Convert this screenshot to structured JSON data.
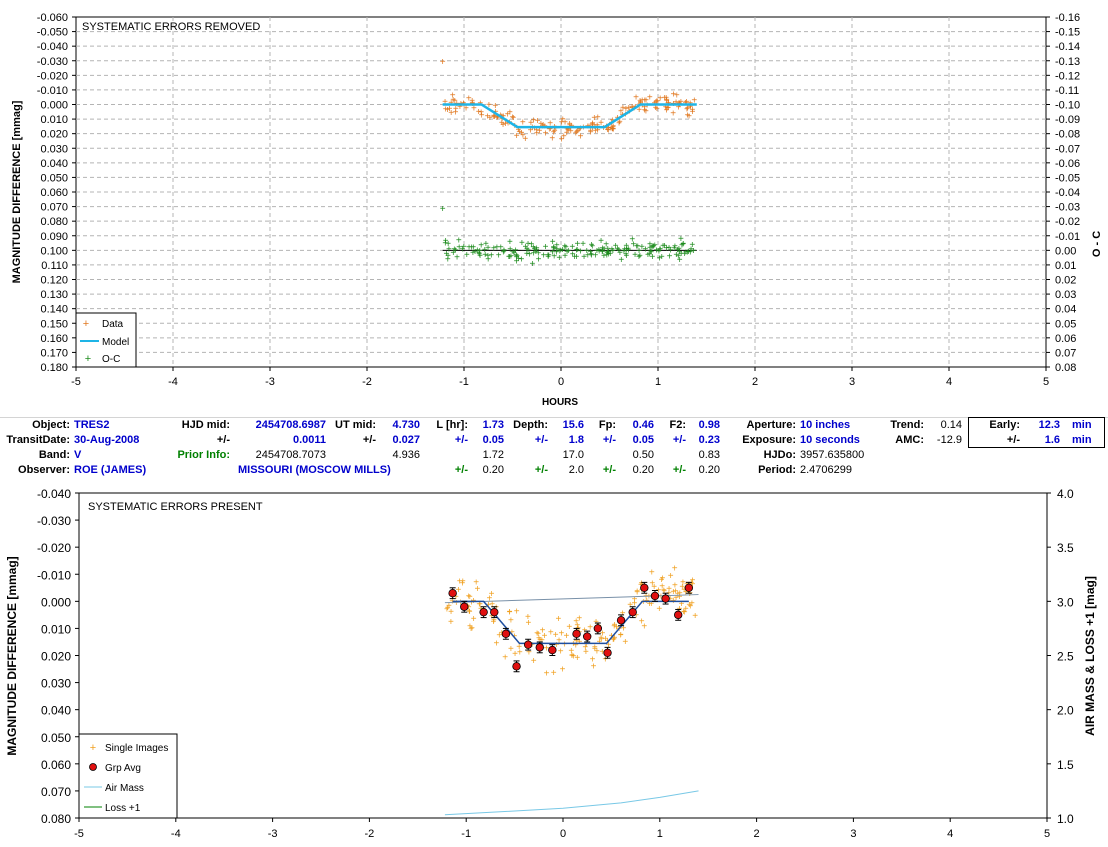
{
  "top": {
    "title": "SYSTEMATIC ERRORS REMOVED",
    "ylabel": "MAGNITUDE DIFFERENCE [mmag]",
    "y2label": "O - C",
    "xlabel": "HOURS",
    "yticks": [
      "-0.060",
      "-0.050",
      "-0.040",
      "-0.030",
      "-0.020",
      "-0.010",
      "0.000",
      "0.010",
      "0.020",
      "0.030",
      "0.040",
      "0.050",
      "0.060",
      "0.070",
      "0.080",
      "0.090",
      "0.100",
      "0.110",
      "0.120",
      "0.130",
      "0.140",
      "0.150",
      "0.160",
      "0.170",
      "0.180"
    ],
    "y2ticks": [
      "-0.16",
      "-0.15",
      "-0.14",
      "-0.13",
      "-0.12",
      "-0.11",
      "-0.10",
      "-0.09",
      "-0.08",
      "-0.07",
      "-0.06",
      "-0.05",
      "-0.04",
      "-0.03",
      "-0.02",
      "-0.01",
      "0.00",
      "0.01",
      "0.02",
      "0.03",
      "0.04",
      "0.05",
      "0.06",
      "0.07",
      "0.08"
    ],
    "xticks": [
      "-5",
      "-4",
      "-3",
      "-2",
      "-1",
      "0",
      "1",
      "2",
      "3",
      "4",
      "5"
    ],
    "legend": [
      "Data",
      "Model",
      "O-C"
    ]
  },
  "bottom": {
    "title": "SYSTEMATIC ERRORS PRESENT",
    "ylabel": "MAGNITUDE DIFFERENCE [mmag]",
    "y2label": "AIR MASS & LOSS +1 [mag]",
    "yticks": [
      "-0.040",
      "-0.030",
      "-0.020",
      "-0.010",
      "0.000",
      "0.010",
      "0.020",
      "0.030",
      "0.040",
      "0.050",
      "0.060",
      "0.070",
      "0.080"
    ],
    "y2ticks": [
      "4.0",
      "3.5",
      "3.0",
      "2.5",
      "2.0",
      "1.5",
      "1.0"
    ],
    "xticks": [
      "-5",
      "-4",
      "-3",
      "-2",
      "-1",
      "0",
      "1",
      "2",
      "3",
      "4",
      "5"
    ],
    "legend": [
      "Single Images",
      "Grp Avg",
      "Air Mass",
      "Loss +1"
    ]
  },
  "info": {
    "object_lbl": "Object:",
    "object": "TRES2",
    "hjdmid_lbl": "HJD mid:",
    "hjdmid": "2454708.6987",
    "utmid_lbl": "UT mid:",
    "utmid": "4.730",
    "L_lbl": "L [hr]:",
    "L": "1.73",
    "depth_lbl": "Depth:",
    "depth": "15.6",
    "fp_lbl": "Fp:",
    "fp": "0.46",
    "f2_lbl": "F2:",
    "f2": "0.98",
    "aperture_lbl": "Aperture:",
    "aperture": "10 inches",
    "trend_lbl": "Trend:",
    "trend": "0.14",
    "early_lbl": "Early:",
    "early": "12.3",
    "early_unit": "min",
    "transitdate_lbl": "TransitDate:",
    "transitdate": "30-Aug-2008",
    "pm": "+/-",
    "hjdmid_err": "0.0011",
    "utmid_err": "0.027",
    "L_err": "0.05",
    "depth_err": "1.8",
    "fp_err": "0.05",
    "f2_err": "0.23",
    "exposure_lbl": "Exposure:",
    "exposure": "10 seconds",
    "amc_lbl": "AMC:",
    "amc": "-12.9",
    "early_err": "1.6",
    "early_err_unit": "min",
    "band_lbl": "Band:",
    "band": "V",
    "prior_lbl": "Prior Info:",
    "prior_hjd": "2454708.7073",
    "prior_ut": "4.936",
    "prior_L": "1.72",
    "prior_depth": "17.0",
    "prior_fp": "0.50",
    "prior_f2": "0.83",
    "hjdo_lbl": "HJDo:",
    "hjdo": "3957.635800",
    "observer_lbl": "Observer:",
    "observer": "ROE (JAMES)",
    "location": "MISSOURI (MOSCOW MILLS)",
    "L_err2": "0.20",
    "depth_err2": "2.0",
    "fp_err2": "0.20",
    "f2_err2": "0.20",
    "period_lbl": "Period:",
    "period": "2.4706299"
  },
  "colors": {
    "data": "#e07820",
    "model": "#1eb4e6",
    "oc": "#1e8c1e",
    "single": "#f0a020",
    "grpavg": "#e01010",
    "airmass": "#78c8e6",
    "loss": "#008000",
    "grid": "#b4b4b4"
  },
  "chart_data": [
    {
      "type": "scatter",
      "title": "SYSTEMATIC ERRORS REMOVED",
      "xlabel": "HOURS",
      "ylabel": "MAGNITUDE DIFFERENCE [mmag]",
      "y2label": "O - C",
      "xlim": [
        -5,
        5
      ],
      "ylim": [
        -0.06,
        0.18
      ],
      "y_inverted": true,
      "y2lim": [
        -0.16,
        0.08
      ],
      "grid": true,
      "legend_position": "bottom-left",
      "series": [
        {
          "name": "Data",
          "marker": "+",
          "x_range": [
            -1.22,
            1.4
          ],
          "y_range": [
            -0.03,
            0.038
          ],
          "outliers": [
            {
              "x": -1.22,
              "y": -0.03
            }
          ]
        },
        {
          "name": "Model",
          "type": "line",
          "x": [
            -1.22,
            -0.82,
            -0.45,
            0.45,
            0.82,
            1.4
          ],
          "y": [
            0.0,
            0.0,
            0.0155,
            0.0155,
            0.0,
            0.0
          ]
        },
        {
          "name": "O-C",
          "marker": "+",
          "axis": "y2",
          "x_range": [
            -1.22,
            1.4
          ],
          "y_range": [
            -0.03,
            0.02
          ],
          "reference_line": 0.0
        }
      ]
    },
    {
      "type": "scatter",
      "title": "SYSTEMATIC ERRORS PRESENT",
      "ylabel": "MAGNITUDE DIFFERENCE [mmag]",
      "y2label": "AIR MASS & LOSS +1 [mag]",
      "xlim": [
        -5,
        5
      ],
      "ylim": [
        -0.04,
        0.08
      ],
      "y_inverted": true,
      "y2lim": [
        1.0,
        4.0
      ],
      "grid": false,
      "legend_position": "bottom-left",
      "series": [
        {
          "name": "Single Images",
          "marker": "+",
          "x_range": [
            -1.22,
            1.4
          ],
          "y_range": [
            -0.027,
            0.038
          ]
        },
        {
          "name": "Grp Avg",
          "marker": "circle",
          "x": [
            -1.14,
            -1.02,
            -0.82,
            -0.71,
            -0.59,
            -0.48,
            -0.36,
            -0.24,
            -0.11,
            0.02,
            0.14,
            0.25,
            0.36,
            0.46,
            0.6,
            0.72,
            0.84,
            0.95,
            1.06,
            1.19,
            1.3
          ],
          "y": [
            -0.003,
            0.002,
            0.004,
            0.004,
            0.012,
            0.024,
            0.016,
            0.017,
            0.018,
            null,
            0.012,
            0.013,
            0.01,
            0.019,
            0.007,
            0.004,
            -0.005,
            -0.002,
            -0.001,
            0.005,
            -0.005
          ],
          "error": 0.002
        },
        {
          "name": "Model",
          "type": "line",
          "x": [
            -1.14,
            -0.82,
            -0.45,
            0.45,
            0.82,
            1.3
          ],
          "y": [
            0.0,
            0.0,
            0.0155,
            0.0155,
            0.0,
            0.0
          ]
        },
        {
          "name": "Baseline",
          "type": "line",
          "x": [
            -1.22,
            1.4
          ],
          "y": [
            0.0005,
            -0.0025
          ]
        },
        {
          "name": "Air Mass",
          "type": "line",
          "axis": "y2",
          "x": [
            -1.22,
            -0.6,
            0.0,
            0.6,
            1.0,
            1.4
          ],
          "y": [
            1.03,
            1.06,
            1.09,
            1.14,
            1.19,
            1.25
          ]
        }
      ]
    }
  ]
}
